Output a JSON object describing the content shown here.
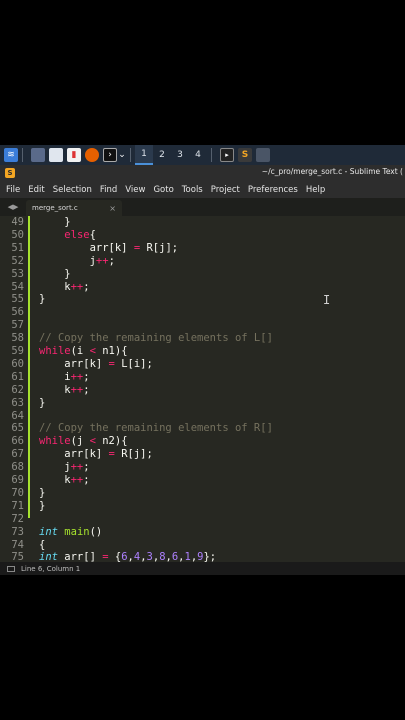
{
  "taskbar": {
    "workspaces": [
      "1",
      "2",
      "3",
      "4"
    ],
    "active_workspace": "1"
  },
  "window": {
    "title": "~/c_pro/merge_sort.c - Sublime Text ("
  },
  "menu": [
    "File",
    "Edit",
    "Selection",
    "Find",
    "View",
    "Goto",
    "Tools",
    "Project",
    "Preferences",
    "Help"
  ],
  "tab": {
    "label": "merge_sort.c",
    "close": "×"
  },
  "status": {
    "position": "Line 6, Column 1"
  },
  "code_lines": [
    {
      "n": "49",
      "t": "        }"
    },
    {
      "n": "50",
      "t": "        else{"
    },
    {
      "n": "51",
      "t": "            arr[k] = R[j];"
    },
    {
      "n": "52",
      "t": "            j++;"
    },
    {
      "n": "53",
      "t": "        }"
    },
    {
      "n": "54",
      "t": "        k++;"
    },
    {
      "n": "55",
      "t": "    }"
    },
    {
      "n": "56",
      "t": ""
    },
    {
      "n": "57",
      "t": ""
    },
    {
      "n": "58",
      "t": "    // Copy the remaining elements of L[]"
    },
    {
      "n": "59",
      "t": "    while(i < n1){"
    },
    {
      "n": "60",
      "t": "        arr[k] = L[i];"
    },
    {
      "n": "61",
      "t": "        i++;"
    },
    {
      "n": "62",
      "t": "        k++;"
    },
    {
      "n": "63",
      "t": "    }"
    },
    {
      "n": "64",
      "t": ""
    },
    {
      "n": "65",
      "t": "    // Copy the remaining elements of R[]"
    },
    {
      "n": "66",
      "t": "    while(j < n2){"
    },
    {
      "n": "67",
      "t": "        arr[k] = R[j];"
    },
    {
      "n": "68",
      "t": "        j++;"
    },
    {
      "n": "69",
      "t": "        k++;"
    },
    {
      "n": "70",
      "t": "    }"
    },
    {
      "n": "71",
      "t": "}"
    },
    {
      "n": "72",
      "t": ""
    },
    {
      "n": "73",
      "t": "int main()"
    },
    {
      "n": "74",
      "t": "{"
    },
    {
      "n": "75",
      "t": "    int arr[] = {6,4,3,8,6,1,9};"
    }
  ],
  "colors": {
    "editor_bg": "#272822",
    "keyword": "#f92672",
    "type": "#66d9ef",
    "function": "#a6e22e",
    "comment": "#75715e",
    "number": "#ae81ff"
  }
}
